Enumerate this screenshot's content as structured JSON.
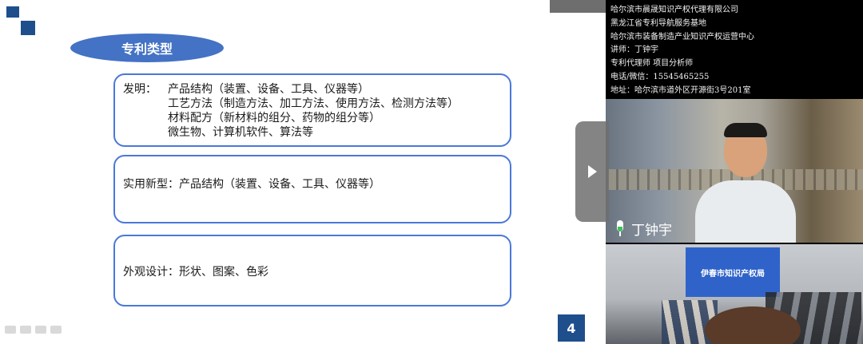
{
  "slide": {
    "section_title": "专利类型",
    "invention": {
      "label": "发明：",
      "lines": [
        "产品结构（装置、设备、工具、仪器等）",
        "工艺方法（制造方法、加工方法、使用方法、检测方法等）",
        "材料配方（新材料的组分、药物的组分等）",
        "微生物、计算机软件、算法等"
      ]
    },
    "utility_model": "实用新型：产品结构（装置、设备、工具、仪器等）",
    "design": "外观设计：形状、图案、色彩",
    "page_number": "4"
  },
  "info_panel": {
    "lines": [
      "哈尔滨市晨晟知识产权代理有限公司",
      "黑龙江省专利导航服务基地",
      "哈尔滨市装备制造产业知识产权运营中心",
      "讲师：丁钟宇",
      "专利代理师 项目分析师",
      "电话/微信：15545465255",
      "地址：哈尔滨市道外区开源街3号201室"
    ]
  },
  "video_presenter": {
    "name": "丁钟宇",
    "mic_icon": "microphone-icon"
  },
  "video_room": {
    "banner_text": "伊春市知识产权局"
  },
  "colors": {
    "accent_blue": "#4472c4",
    "logo_blue": "#1f4e8c",
    "card_border": "#4a78d8"
  }
}
